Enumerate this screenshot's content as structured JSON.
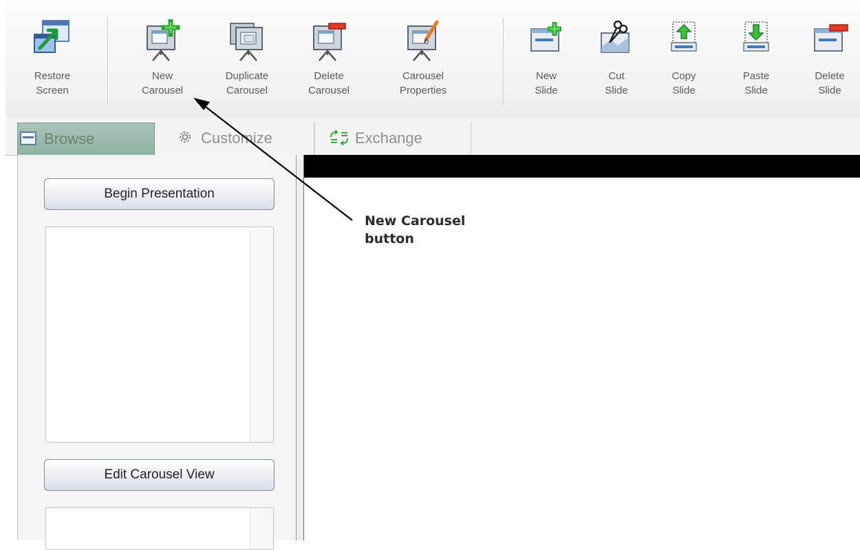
{
  "toolbar": {
    "buttons": [
      {
        "line1": "Restore",
        "line2": "Screen",
        "icon": "restore-screen-icon"
      },
      {
        "line1": "New",
        "line2": "Carousel",
        "icon": "new-carousel-icon"
      },
      {
        "line1": "Duplicate",
        "line2": "Carousel",
        "icon": "duplicate-carousel-icon"
      },
      {
        "line1": "Delete",
        "line2": "Carousel",
        "icon": "delete-carousel-icon"
      },
      {
        "line1": "Carousel",
        "line2": "Properties",
        "icon": "carousel-properties-icon"
      },
      {
        "line1": "New",
        "line2": "Slide",
        "icon": "new-slide-icon"
      },
      {
        "line1": "Cut",
        "line2": "Slide",
        "icon": "cut-slide-icon"
      },
      {
        "line1": "Copy",
        "line2": "Slide",
        "icon": "copy-slide-icon"
      },
      {
        "line1": "Paste",
        "line2": "Slide",
        "icon": "paste-slide-icon"
      },
      {
        "line1": "Delete",
        "line2": "Slide",
        "icon": "delete-slide-icon"
      }
    ]
  },
  "tabs": [
    {
      "label": "Browse",
      "icon": "browse-icon",
      "active": true
    },
    {
      "label": "Customize",
      "icon": "gear-icon",
      "active": false
    },
    {
      "label": "Exchange",
      "icon": "exchange-icon",
      "active": false
    }
  ],
  "left_panel": {
    "begin_presentation_label": "Begin Presentation",
    "edit_carousel_view_label": "Edit Carousel View"
  },
  "annotation": {
    "line1": "New Carousel",
    "line2": "button"
  },
  "colors": {
    "active_tab": "#9dbdb0",
    "toolbar_label": "#5a5a5a",
    "content_header": "#000000",
    "plus_green": "#3cbf3c",
    "delete_red": "#e03a2a"
  }
}
